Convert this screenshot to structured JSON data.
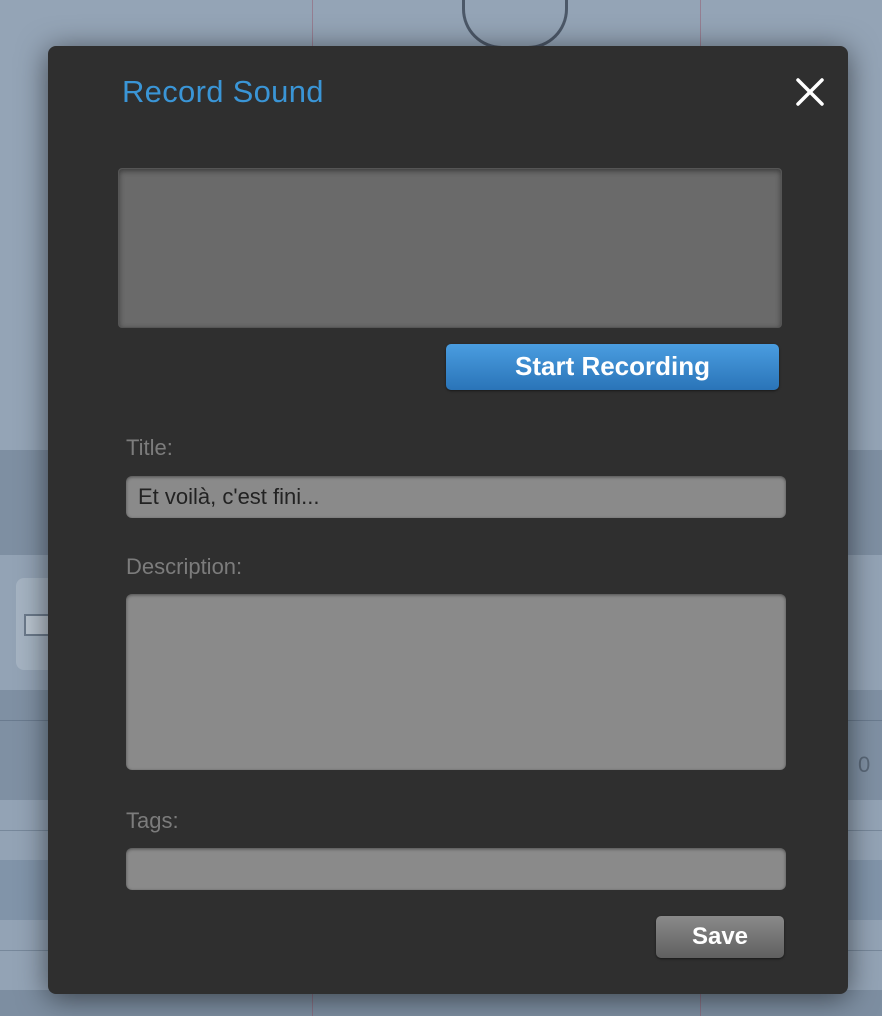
{
  "dialog": {
    "title": "Record Sound",
    "close_icon": "close-x-icon",
    "accent_color": "#3a95d6",
    "record_button_label": "Start Recording",
    "fields": {
      "title_label": "Title:",
      "title_value": "Et voilà, c'est fini...",
      "description_label": "Description:",
      "description_value": "",
      "tags_label": "Tags:",
      "tags_value": ""
    },
    "save_button_label": "Save"
  },
  "background": {
    "edge_text": "0"
  }
}
